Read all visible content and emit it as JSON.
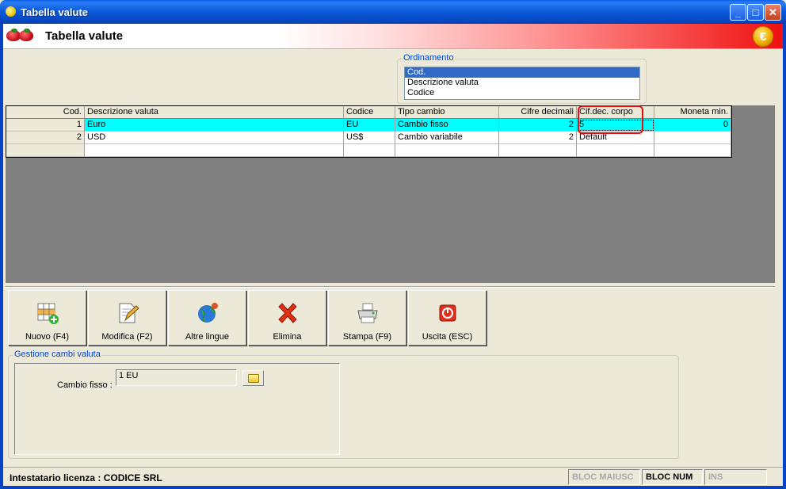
{
  "window": {
    "title": "Tabella valute"
  },
  "header": {
    "title": "Tabella valute"
  },
  "ordinamento": {
    "legend": "Ordinamento",
    "options": [
      "Cod.",
      "Descrizione valuta",
      "Codice"
    ],
    "selected": "Cod."
  },
  "grid": {
    "columns": [
      "Cod.",
      "Descrizione valuta",
      "Codice",
      "Tipo cambio",
      "Cifre decimali",
      "Cif.dec. corpo",
      "Moneta min."
    ],
    "rows": [
      [
        "1",
        "Euro",
        "EU",
        "Cambio fisso",
        "2",
        "5",
        "0"
      ],
      [
        "2",
        "USD",
        "US$",
        "Cambio variabile",
        "2",
        "Default",
        ""
      ]
    ]
  },
  "toolbar": {
    "new": "Nuovo (F4)",
    "edit": "Modifica (F2)",
    "languages": "Altre lingue",
    "delete": "Elimina",
    "print": "Stampa (F9)",
    "exit": "Uscita (ESC)"
  },
  "gestione": {
    "legend": "Gestione cambi valuta",
    "label": "Cambio fisso :",
    "value": "1 EU"
  },
  "status": {
    "license": "Intestatario licenza : CODICE SRL",
    "caps": "BLOC MAIUSC",
    "num": "BLOC NUM",
    "ins": "INS"
  },
  "colors": {
    "accent": "#316ac5",
    "selection": "#00ffff",
    "highlight": "#e01010"
  }
}
